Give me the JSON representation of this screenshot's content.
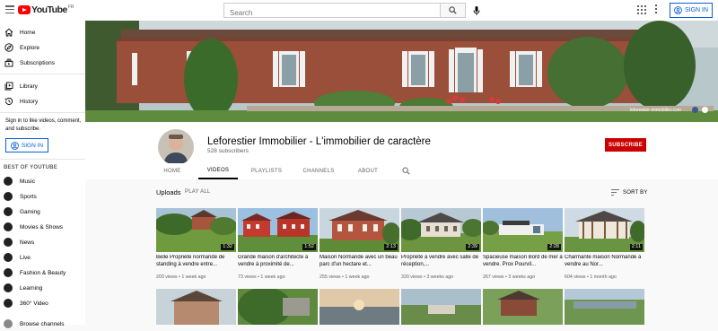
{
  "header": {
    "logo_text": "YouTube",
    "logo_region": "FR",
    "search_placeholder": "Search",
    "signin_label": "SIGN IN"
  },
  "sidebar": {
    "items": [
      {
        "label": "Home",
        "icon": "home-icon"
      },
      {
        "label": "Explore",
        "icon": "compass-icon"
      },
      {
        "label": "Subscriptions",
        "icon": "subscriptions-icon"
      },
      {
        "label": "Library",
        "icon": "library-icon"
      },
      {
        "label": "History",
        "icon": "history-icon"
      }
    ],
    "signin_text": "Sign in to like videos, comment, and subscribe.",
    "signin_label": "SIGN IN",
    "best_header": "BEST OF YOUTUBE",
    "best_items": [
      {
        "label": "Music",
        "icon": "music-icon"
      },
      {
        "label": "Sports",
        "icon": "trophy-icon"
      },
      {
        "label": "Gaming",
        "icon": "gamepad-icon"
      },
      {
        "label": "Movies & Shows",
        "icon": "film-icon"
      },
      {
        "label": "News",
        "icon": "news-icon"
      },
      {
        "label": "Live",
        "icon": "live-icon"
      },
      {
        "label": "Fashion & Beauty",
        "icon": "hanger-icon"
      },
      {
        "label": "Learning",
        "icon": "lightbulb-icon"
      },
      {
        "label": "360° Video",
        "icon": "360-icon"
      },
      {
        "label": "Browse channels",
        "icon": "plus-circle-icon"
      }
    ]
  },
  "banner": {
    "url_text": "leforestier-immobilier.com"
  },
  "channel": {
    "name": "Leforestier Immobilier - L'immobilier de caractère",
    "subscribers": "528 subscribers",
    "subscribe_label": "SUBSCRIBE"
  },
  "tabs": [
    "HOME",
    "VIDEOS",
    "PLAYLISTS",
    "CHANNELS",
    "ABOUT"
  ],
  "active_tab": "VIDEOS",
  "uploads": {
    "title": "Uploads",
    "play_all": "PLAY ALL",
    "sort_by": "SORT BY"
  },
  "videos": [
    {
      "title": "Belle Propriété normande de standing à vendre entre...",
      "views": "203 views",
      "age": "1 week ago",
      "duration": "1:32"
    },
    {
      "title": "Grande maison d'architecte à vendre à proximité de...",
      "views": "73 views",
      "age": "1 week ago",
      "duration": "1:52"
    },
    {
      "title": "Maison Normande avec un beau parc d'un hectare et...",
      "views": "255 views",
      "age": "1 week ago",
      "duration": "2:13"
    },
    {
      "title": "Propriété à vendre avec salle de réception,...",
      "views": "320 views",
      "age": "3 weeks ago",
      "duration": "2:39"
    },
    {
      "title": "Spacieuse maison Bord de mer à vendre. Prox Pourvil...",
      "views": "267 views",
      "age": "3 weeks ago",
      "duration": "2:28"
    },
    {
      "title": "Charmante maison Normande à vendre au Nor...",
      "views": "604 views",
      "age": "1 month ago",
      "duration": "2:11"
    }
  ],
  "colors": {
    "brand_red": "#ff0000",
    "subscribe_red": "#cc0000",
    "link_blue": "#065fd4"
  }
}
